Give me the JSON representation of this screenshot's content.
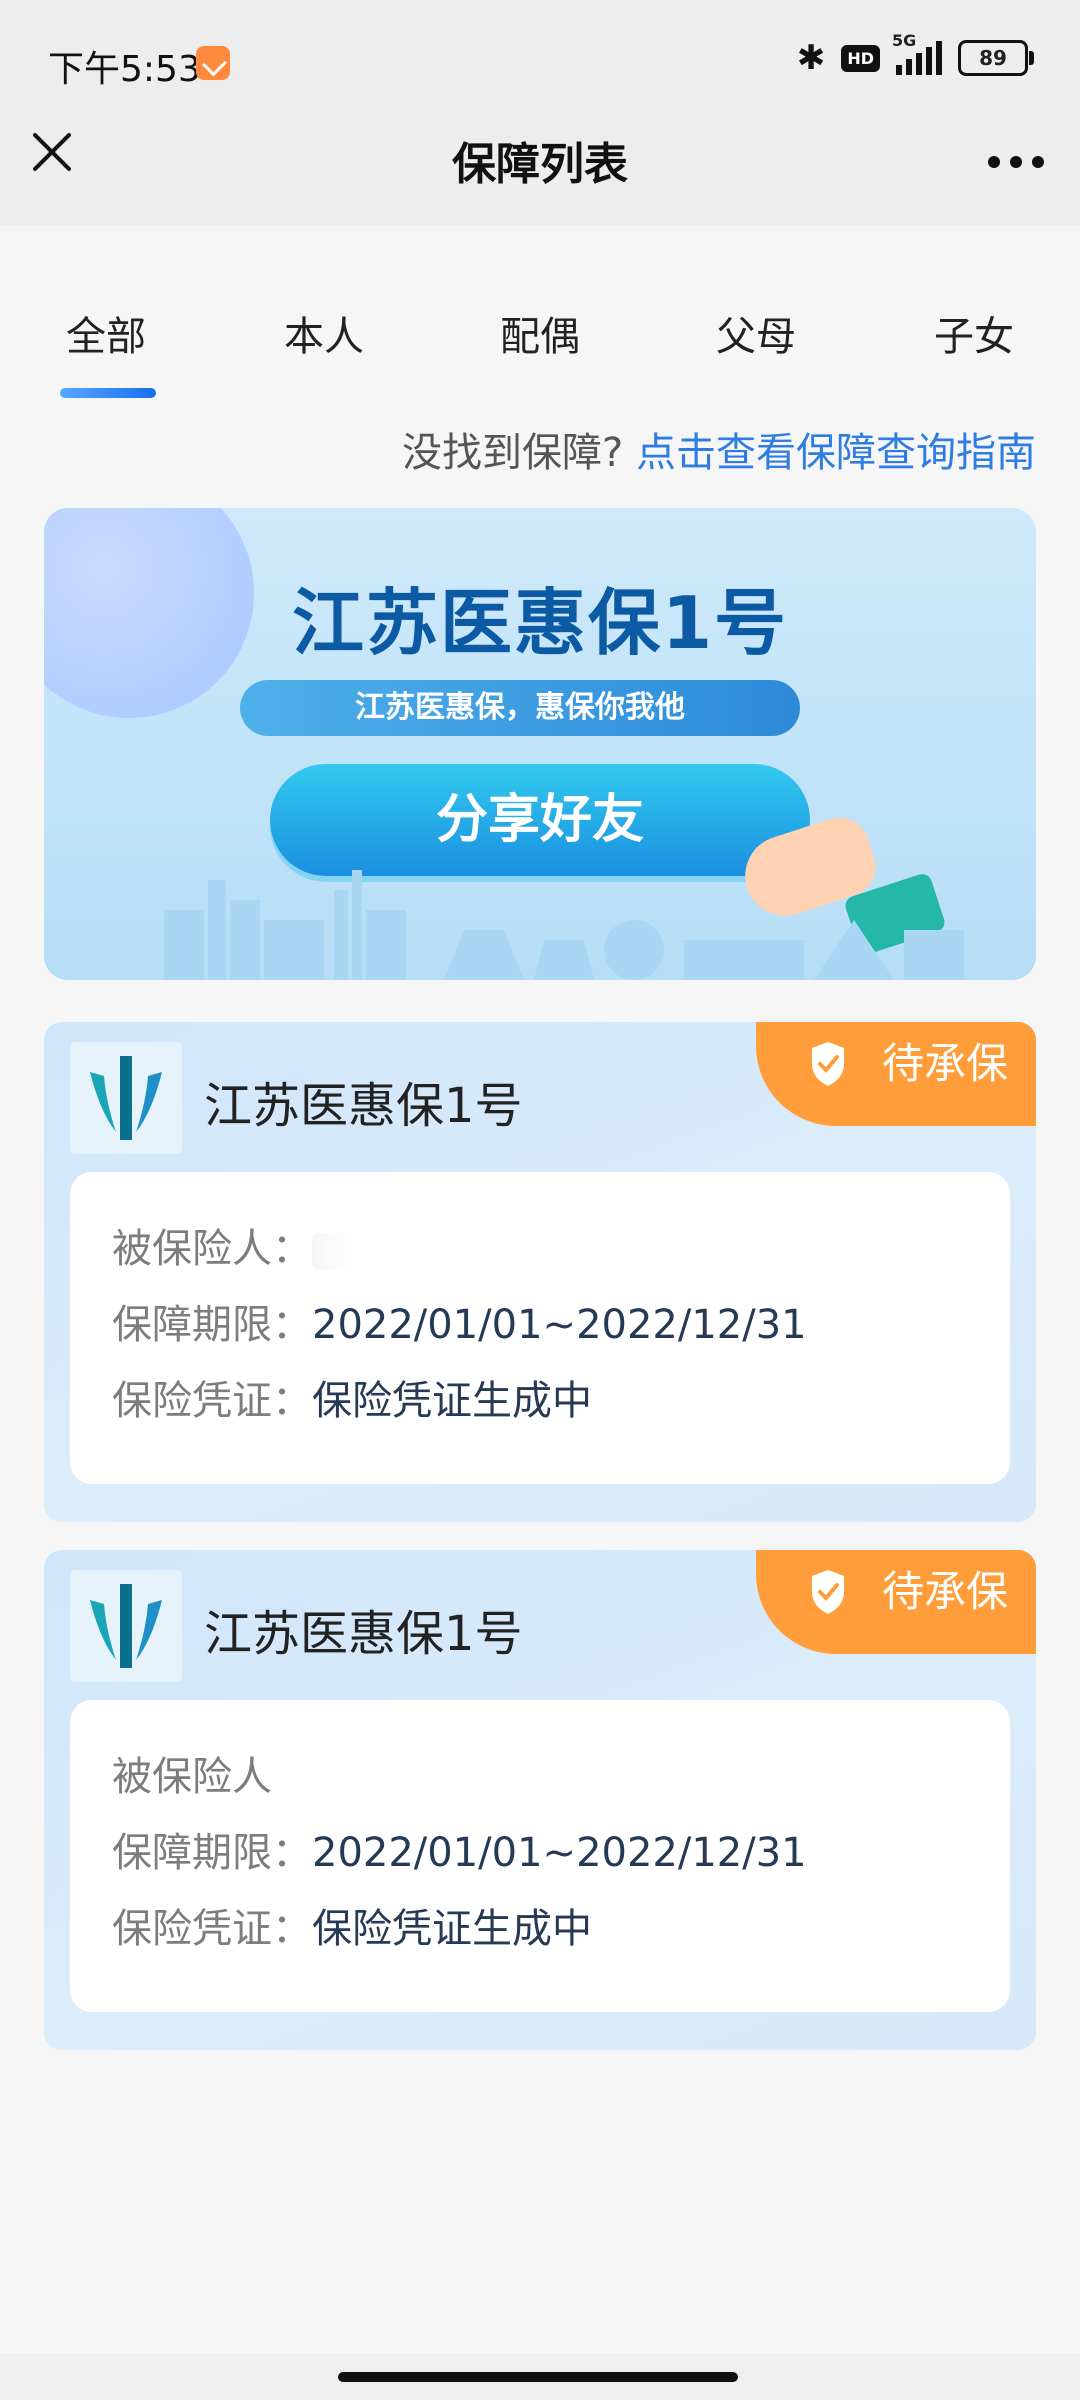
{
  "status": {
    "time": "下午5:53",
    "network": "5G",
    "hd_label": "HD",
    "battery": "89"
  },
  "nav": {
    "title": "保障列表"
  },
  "tabs": [
    {
      "label": "全部",
      "active": true
    },
    {
      "label": "本人",
      "active": false
    },
    {
      "label": "配偶",
      "active": false
    },
    {
      "label": "父母",
      "active": false
    },
    {
      "label": "子女",
      "active": false
    }
  ],
  "hint": {
    "question": "没找到保障?",
    "link": "点击查看保障查询指南"
  },
  "banner": {
    "title": "江苏医惠保1号",
    "slogan": "江苏医惠保，惠保你我他",
    "button": "分享好友"
  },
  "cards": [
    {
      "title": "江苏医惠保1号",
      "status": "待承保",
      "insured_label": "被保险人：",
      "insured_value": "",
      "period_label": "保障期限：",
      "period_value": "2022/01/01~2022/12/31",
      "cert_label": "保险凭证：",
      "cert_value": "保险凭证生成中"
    },
    {
      "title": "江苏医惠保1号",
      "status": "待承保",
      "insured_label": "被保险人",
      "insured_value": "",
      "period_label": "保障期限：",
      "period_value": "2022/01/01~2022/12/31",
      "cert_label": "保险凭证：",
      "cert_value": "保险凭证生成中"
    }
  ],
  "colors": {
    "accent": "#2f7de1",
    "badge": "#ff9d3a",
    "banner_text": "#0c5aa3"
  }
}
